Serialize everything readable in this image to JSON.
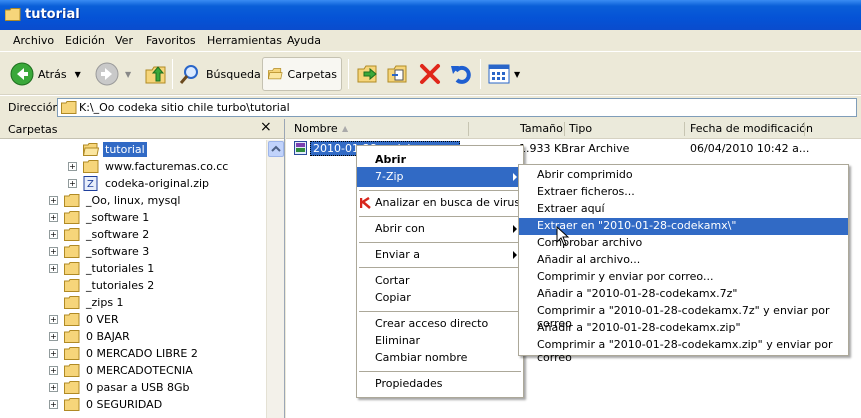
{
  "window": {
    "title": "tutorial"
  },
  "menubar": [
    "Archivo",
    "Edición",
    "Ver",
    "Favoritos",
    "Herramientas",
    "Ayuda"
  ],
  "toolbar": {
    "back_label": "Atrás",
    "search_label": "Búsqueda",
    "folders_label": "Carpetas"
  },
  "address": {
    "label": "Dirección",
    "value": "K:\\_Oo codeka sitio chile turbo\\tutorial"
  },
  "folders_panel": {
    "title": "Carpetas",
    "close": "×",
    "tree": [
      {
        "label": "tutorial",
        "selected": true
      },
      {
        "label": "www.facturemas.co.cc"
      },
      {
        "label": "codeka-original.zip"
      },
      {
        "label": "_Oo, linux, mysql"
      },
      {
        "label": "_software 1"
      },
      {
        "label": "_software 2"
      },
      {
        "label": "_software 3"
      },
      {
        "label": "_tutoriales 1"
      },
      {
        "label": "_tutoriales 2"
      },
      {
        "label": "_zips 1"
      },
      {
        "label": "0 VER"
      },
      {
        "label": "0 BAJAR"
      },
      {
        "label": "0 MERCADO LIBRE 2"
      },
      {
        "label": "0 MERCADOTECNIA"
      },
      {
        "label": "0 pasar a USB 8Gb"
      },
      {
        "label": "0 SEGURIDAD"
      }
    ]
  },
  "file_list": {
    "columns": [
      "Nombre",
      "Tamaño",
      "Tipo",
      "Fecha de modificación"
    ],
    "rows": [
      {
        "name": "2010-01-28-codekamx.rar",
        "size": "1.933 KB",
        "type": "rar Archive",
        "modified": "06/04/2010 10:42 a..."
      }
    ]
  },
  "context_menu": {
    "items": [
      "Abrir",
      "7-Zip",
      "Analizar en busca de virus",
      "Abrir con",
      "Enviar a",
      "Cortar",
      "Copiar",
      "Crear acceso directo",
      "Eliminar",
      "Cambiar nombre",
      "Propiedades"
    ]
  },
  "submenu_7zip": {
    "items": [
      "Abrir comprimido",
      "Extraer ficheros...",
      "Extraer aquí",
      "Extraer en \"2010-01-28-codekamx\\\"",
      "Comprobar archivo",
      "Añadir al archivo...",
      "Comprimir y enviar por correo...",
      "Añadir a \"2010-01-28-codekamx.7z\"",
      "Comprimir a \"2010-01-28-codekamx.7z\" y enviar por correo",
      "Añadir a \"2010-01-28-codekamx.zip\"",
      "Comprimir a \"2010-01-28-codekamx.zip\" y enviar por correo"
    ]
  },
  "colors": {
    "selection": "#316ac5",
    "titlebar": "#0553d6",
    "chrome": "#ece9d8",
    "folder": "#f6d57a"
  }
}
